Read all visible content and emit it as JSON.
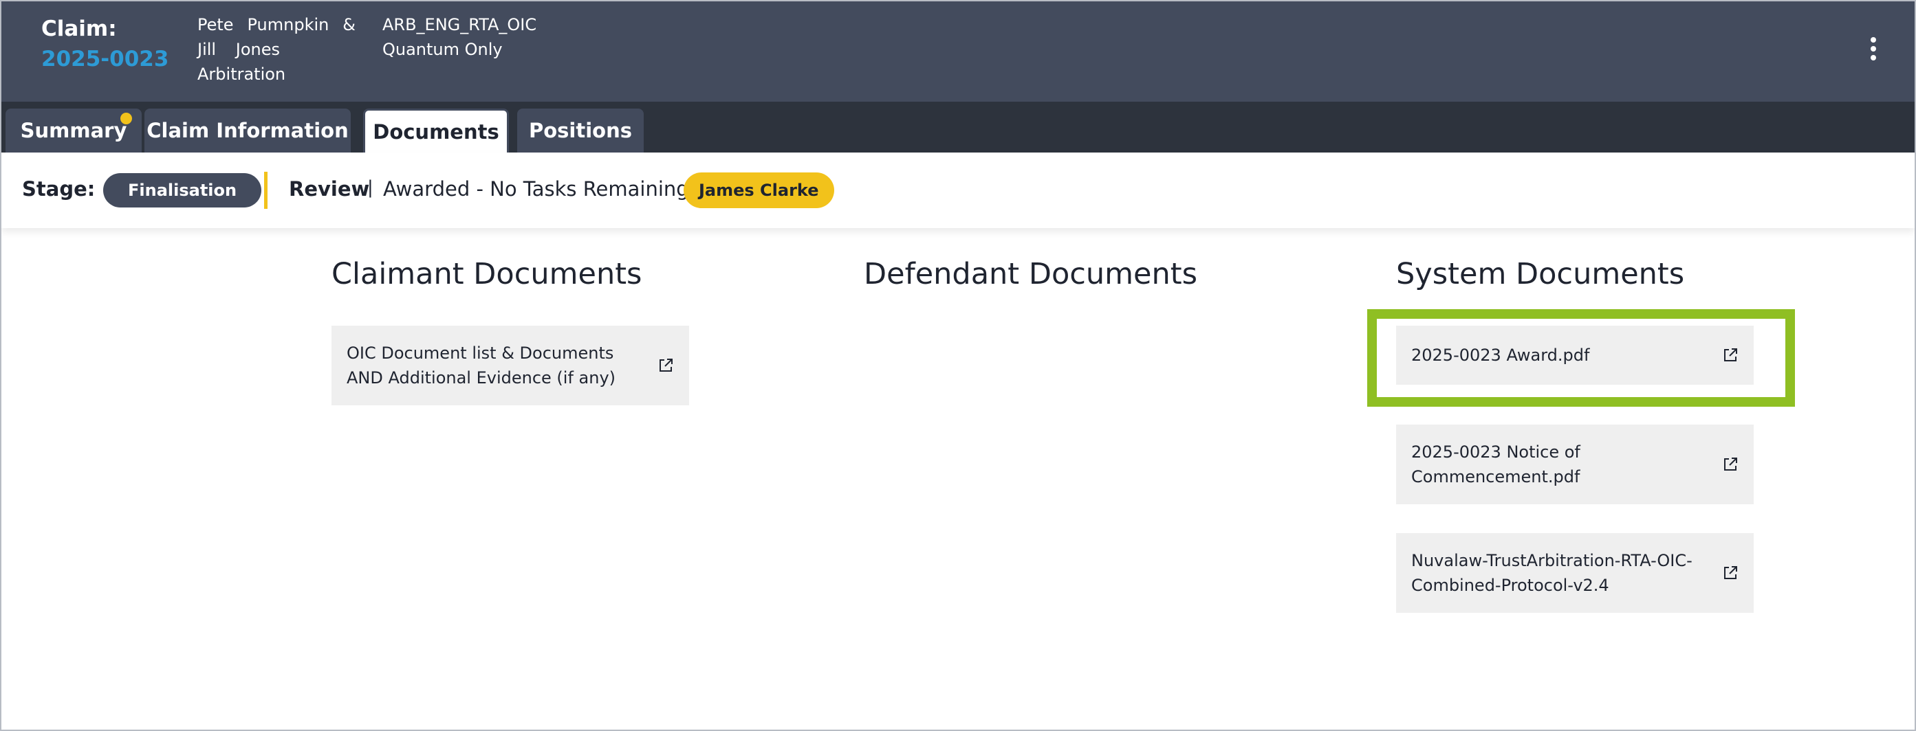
{
  "header": {
    "claim_label": "Claim:",
    "claim_number": "2025-0023",
    "parties": {
      "line1_left": "Pete",
      "line1_mid": "Pumnpkin",
      "line1_right": "&",
      "line2_left": "Jill",
      "line2_right": "Jones",
      "line3": "Arbitration"
    },
    "meta": {
      "code": "ARB_ENG_RTA_OIC",
      "type": "Quantum Only"
    },
    "menu_icon": "kebab-vertical-icon"
  },
  "tabs": [
    {
      "label": "Summary",
      "active": false,
      "has_notification": true
    },
    {
      "label": "Claim Information",
      "active": false,
      "has_notification": false
    },
    {
      "label": "Documents",
      "active": true,
      "has_notification": false
    },
    {
      "label": "Positions",
      "active": false,
      "has_notification": false
    }
  ],
  "stage": {
    "label": "Stage:",
    "value": "Finalisation",
    "review_label": "Review",
    "separator": "|",
    "review_status": "Awarded - No Tasks Remaining",
    "assignee": "James Clarke"
  },
  "columns": {
    "claimant": {
      "title": "Claimant Documents",
      "documents": [
        {
          "name": "OIC Document list & Documents AND Additional Evidence (if any)",
          "icon": "external-link-icon"
        }
      ]
    },
    "defendant": {
      "title": "Defendant Documents",
      "documents": []
    },
    "system": {
      "title": "System Documents",
      "documents": [
        {
          "name": "2025-0023 Award.pdf",
          "icon": "external-link-icon",
          "highlighted": true
        },
        {
          "name": "2025-0023 Notice of Commencement.pdf",
          "icon": "external-link-icon"
        },
        {
          "name": "Nuvalaw-TrustArbitration-RTA-OIC-Combined-Protocol-v2.4",
          "icon": "external-link-icon"
        }
      ]
    }
  },
  "colors": {
    "header_bg": "#434b5d",
    "tabbar_bg": "#2d333d",
    "accent_blue": "#2d9bd6",
    "accent_yellow": "#f2c21b",
    "highlight_green": "#8fbf23",
    "card_bg": "#efefef"
  }
}
